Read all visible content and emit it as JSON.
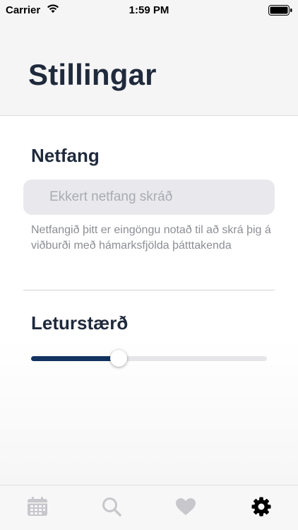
{
  "status_bar": {
    "carrier": "Carrier",
    "time": "1:59 PM"
  },
  "header": {
    "title": "Stillingar"
  },
  "email_section": {
    "title": "Netfang",
    "value": "",
    "placeholder": "Ekkert netfang skráð",
    "help_text": "Netfangið þitt er eingöngu notað til að skrá þig á viðburði með hámarksfjölda þátttakenda"
  },
  "font_size_section": {
    "title": "Leturstærð",
    "slider_value": 0.37
  },
  "tab_bar": {
    "tabs": [
      {
        "icon": "calendar-icon",
        "active": false
      },
      {
        "icon": "search-icon",
        "active": false
      },
      {
        "icon": "heart-icon",
        "active": false
      },
      {
        "icon": "gear-icon",
        "active": true
      }
    ]
  },
  "colors": {
    "title_text": "#1f2a3c",
    "accent": "#12335f",
    "tab_inactive": "#c7c7cc",
    "tab_active": "#000000",
    "field_background": "#e9e9ed"
  }
}
